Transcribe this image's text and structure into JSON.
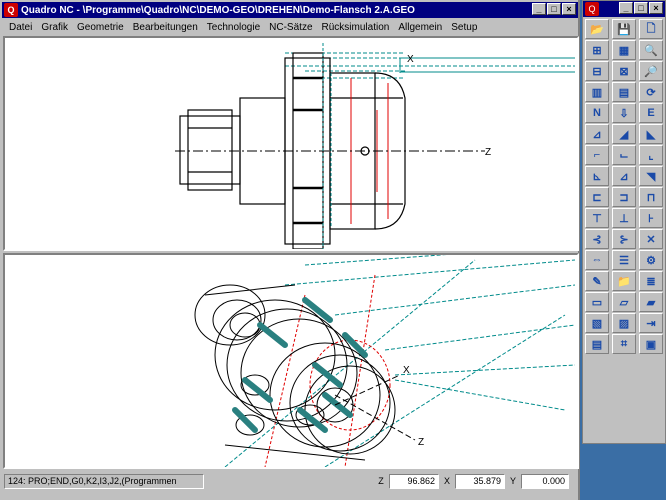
{
  "window": {
    "title": "Quadro NC - \\Programme\\Quadro\\NC\\DEMO-GEO\\DREHEN\\Demo-Flansch 2.A.GEO",
    "icon": "quadro-nc-app-icon",
    "btn_min": "_",
    "btn_max": "□",
    "btn_close": "×"
  },
  "menu": [
    "Datei",
    "Grafik",
    "Geometrie",
    "Bearbeitungen",
    "Technologie",
    "NC-Sätze",
    "Rücksimulation",
    "Allgemein",
    "Setup"
  ],
  "viewport_top": {
    "axis_x": "X",
    "axis_z": "Z"
  },
  "viewport_bottom": {
    "axis_x": "X",
    "axis_z": "Z"
  },
  "status": {
    "nc_line": "124: PRO;END,G0,K2,I3,J2,(Programmen",
    "z_label": "Z",
    "z_value": "96.862",
    "x_label": "X",
    "x_value": "35.879",
    "y_label": "Y",
    "y_value": "0.000"
  },
  "toolbar": {
    "tools": [
      "open-folder-icon",
      "save-disk-icon",
      "new-page-icon",
      "add-window-icon",
      "grid-icon",
      "zoom-icon",
      "arrange-icon",
      "window-arrange-icon",
      "zoom-all-icon",
      "split-icon",
      "split-2-icon",
      "rotate-icon",
      "nc-rnf-icon",
      "down-arrow-icon",
      "nc-end-icon",
      "turn-tool-1-icon",
      "tool-2-icon",
      "tool-3-icon",
      "contour-1-icon",
      "contour-2-icon",
      "contour-3-icon",
      "thread-1-icon",
      "thread-2-icon",
      "thread-3-icon",
      "groove-1-icon",
      "groove-2-icon",
      "groove-3-icon",
      "drill-1-icon",
      "drill-2-icon",
      "drill-3-icon",
      "cut-1-icon",
      "cut-2-icon",
      "delete-x-icon",
      "link-icon",
      "list-icon",
      "nc-settings-icon",
      "pencil-icon",
      "folder-open-icon",
      "nc-params-icon",
      "simulate-1-icon",
      "simulate-2-icon",
      "simulate-3-icon",
      "chip-1-icon",
      "chip-2-icon",
      "end-arrow-icon",
      "tool-table-icon",
      "nc-cycle-icon",
      "exit-icon"
    ],
    "glyphs": [
      "📂",
      "💾",
      "🗋",
      "⊞",
      "▦",
      "🔍",
      "⊟",
      "⊠",
      "🔎",
      "▥",
      "▤",
      "⟳",
      "N",
      "⇩",
      "E",
      "⊿",
      "◢",
      "◣",
      "⌐",
      "⌙",
      "⌞",
      "⊾",
      "⊿",
      "◥",
      "⊏",
      "⊐",
      "⊓",
      "⊤",
      "⊥",
      "⊦",
      "⊰",
      "⊱",
      "✕",
      "⇔",
      "☰",
      "⚙",
      "✎",
      "📁",
      "≣",
      "▭",
      "▱",
      "▰",
      "▧",
      "▨",
      "⇥",
      "▤",
      "⌗",
      "▣"
    ]
  },
  "colors": {
    "titlebar": "#000080",
    "face": "#c0c0c0",
    "cyan": "#008b8b",
    "red": "#e00000"
  }
}
